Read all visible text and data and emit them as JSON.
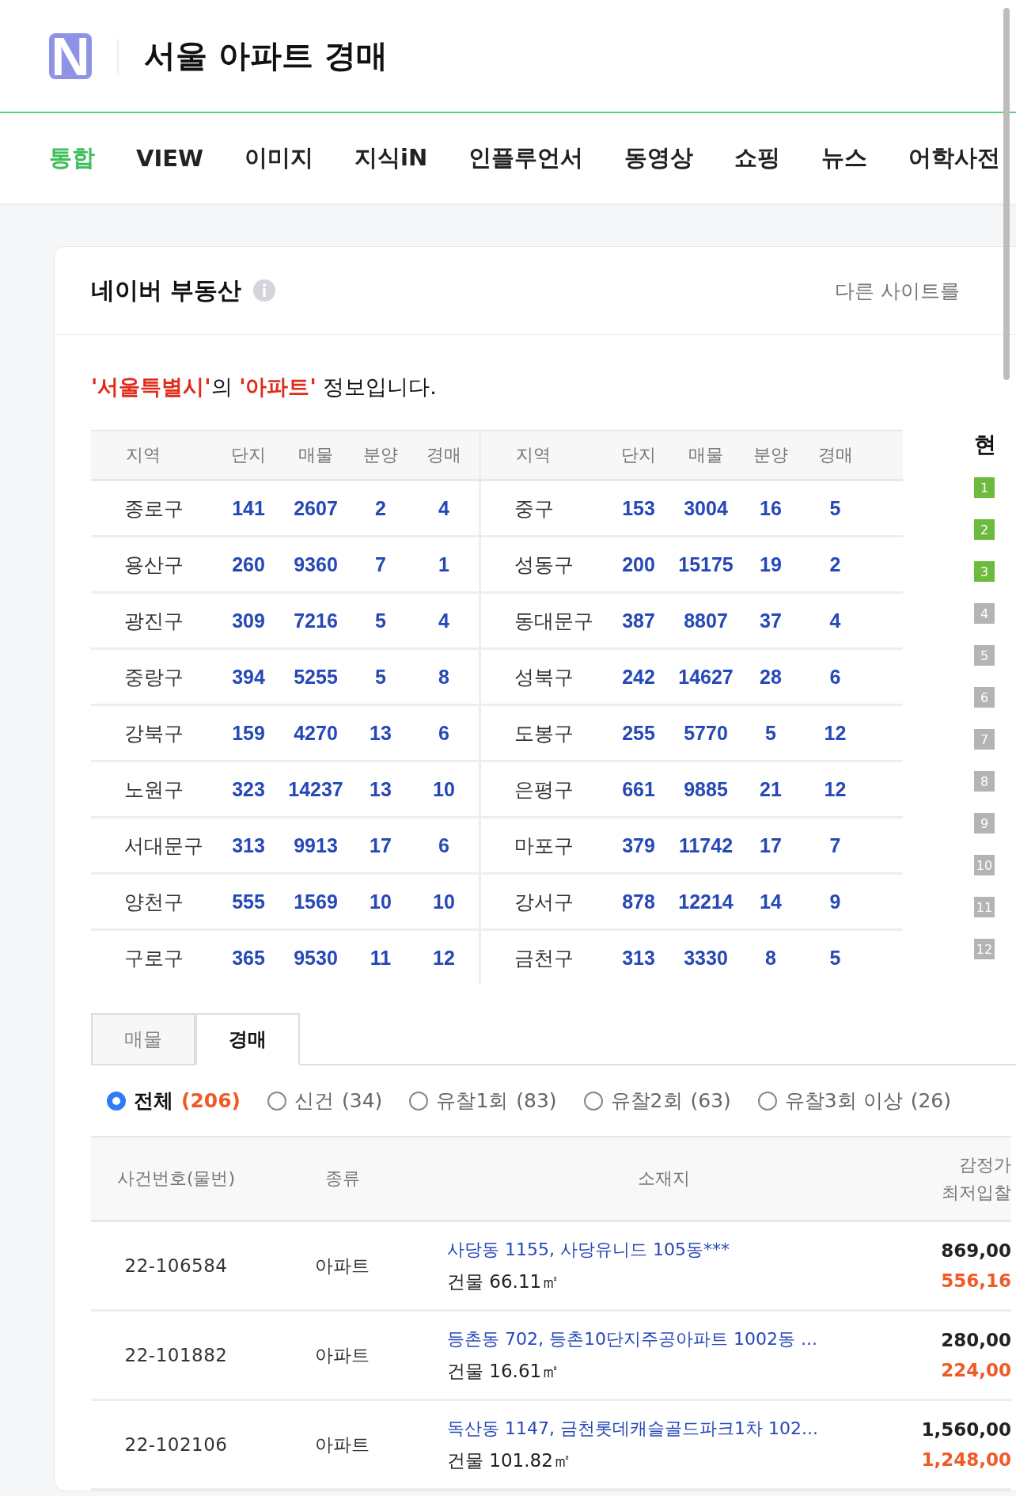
{
  "header": {
    "logo_text": "N",
    "title": "서울 아파트 경매"
  },
  "nav_tabs": [
    {
      "label": "통합",
      "selected": true
    },
    {
      "label": "VIEW",
      "selected": false
    },
    {
      "label": "이미지",
      "selected": false
    },
    {
      "label": "지식iN",
      "selected": false
    },
    {
      "label": "인플루언서",
      "selected": false
    },
    {
      "label": "동영상",
      "selected": false
    },
    {
      "label": "쇼핑",
      "selected": false
    },
    {
      "label": "뉴스",
      "selected": false
    },
    {
      "label": "어학사전",
      "selected": false
    }
  ],
  "card": {
    "title": "네이버 부동산",
    "side_link": "다른 사이트를",
    "intro": [
      {
        "text": "'서울특별시'",
        "highlight": true
      },
      {
        "text": "의 ",
        "highlight": false
      },
      {
        "text": "'아파트'",
        "highlight": true
      },
      {
        "text": " 정보입니다.",
        "highlight": false
      }
    ],
    "district_table": {
      "columns": [
        "지역",
        "단지",
        "매물",
        "분양",
        "경매",
        "지역",
        "단지",
        "매물",
        "분양",
        "경매"
      ],
      "rows": [
        [
          "종로구",
          "141",
          "2607",
          "2",
          "4",
          "중구",
          "153",
          "3004",
          "16",
          "5"
        ],
        [
          "용산구",
          "260",
          "9360",
          "7",
          "1",
          "성동구",
          "200",
          "15175",
          "19",
          "2"
        ],
        [
          "광진구",
          "309",
          "7216",
          "5",
          "4",
          "동대문구",
          "387",
          "8807",
          "37",
          "4"
        ],
        [
          "중랑구",
          "394",
          "5255",
          "5",
          "8",
          "성북구",
          "242",
          "14627",
          "28",
          "6"
        ],
        [
          "강북구",
          "159",
          "4270",
          "13",
          "6",
          "도봉구",
          "255",
          "5770",
          "5",
          "12"
        ],
        [
          "노원구",
          "323",
          "14237",
          "13",
          "10",
          "은평구",
          "661",
          "9885",
          "21",
          "12"
        ],
        [
          "서대문구",
          "313",
          "9913",
          "17",
          "6",
          "마포구",
          "379",
          "11742",
          "17",
          "7"
        ],
        [
          "양천구",
          "555",
          "1569",
          "10",
          "10",
          "강서구",
          "878",
          "12214",
          "14",
          "9"
        ],
        [
          "구로구",
          "365",
          "9530",
          "11",
          "12",
          "금천구",
          "313",
          "3330",
          "8",
          "5"
        ]
      ]
    },
    "ranking": {
      "title": "현",
      "badges": [
        {
          "label": "1",
          "color": "#6cbb3c"
        },
        {
          "label": "2",
          "color": "#6cbb3c"
        },
        {
          "label": "3",
          "color": "#6cbb3c"
        },
        {
          "label": "4",
          "color": "#b4b4b4"
        },
        {
          "label": "5",
          "color": "#b4b4b4"
        },
        {
          "label": "6",
          "color": "#b4b4b4"
        },
        {
          "label": "7",
          "color": "#b4b4b4"
        },
        {
          "label": "8",
          "color": "#b4b4b4"
        },
        {
          "label": "9",
          "color": "#b4b4b4"
        },
        {
          "label": "10",
          "color": "#b4b4b4"
        },
        {
          "label": "11",
          "color": "#b4b4b4"
        },
        {
          "label": "12",
          "color": "#b4b4b4"
        }
      ]
    },
    "sub_tabs": [
      {
        "label": "매물",
        "selected": false
      },
      {
        "label": "경매",
        "selected": true
      }
    ],
    "filters": [
      {
        "label": "전체",
        "count": "(206)",
        "selected": true
      },
      {
        "label": "신건",
        "count": "(34)",
        "selected": false
      },
      {
        "label": "유찰1회",
        "count": "(83)",
        "selected": false
      },
      {
        "label": "유찰2회",
        "count": "(63)",
        "selected": false
      },
      {
        "label": "유찰3회 이상",
        "count": "(26)",
        "selected": false
      }
    ],
    "auction_table": {
      "columns": [
        "사건번호(물번)",
        "종류",
        "소재지"
      ],
      "price_column": [
        "감정가",
        "최저입찰"
      ],
      "rows": [
        {
          "case_no": "22-106584",
          "type": "아파트",
          "address": "사당동 1155, 사당유니드 105동***",
          "area": "건물 66.11㎡",
          "appraisal": "869,00",
          "min_bid": "556,16"
        },
        {
          "case_no": "22-101882",
          "type": "아파트",
          "address": "등촌동 702, 등촌10단지주공아파트 1002동 ...",
          "area": "건물 16.61㎡",
          "appraisal": "280,00",
          "min_bid": "224,00"
        },
        {
          "case_no": "22-102106",
          "type": "아파트",
          "address": "독산동 1147, 금천롯데캐슬골드파크1차 102...",
          "area": "건물 101.82㎡",
          "appraisal": "1,560,00",
          "min_bid": "1,248,00"
        }
      ]
    }
  }
}
